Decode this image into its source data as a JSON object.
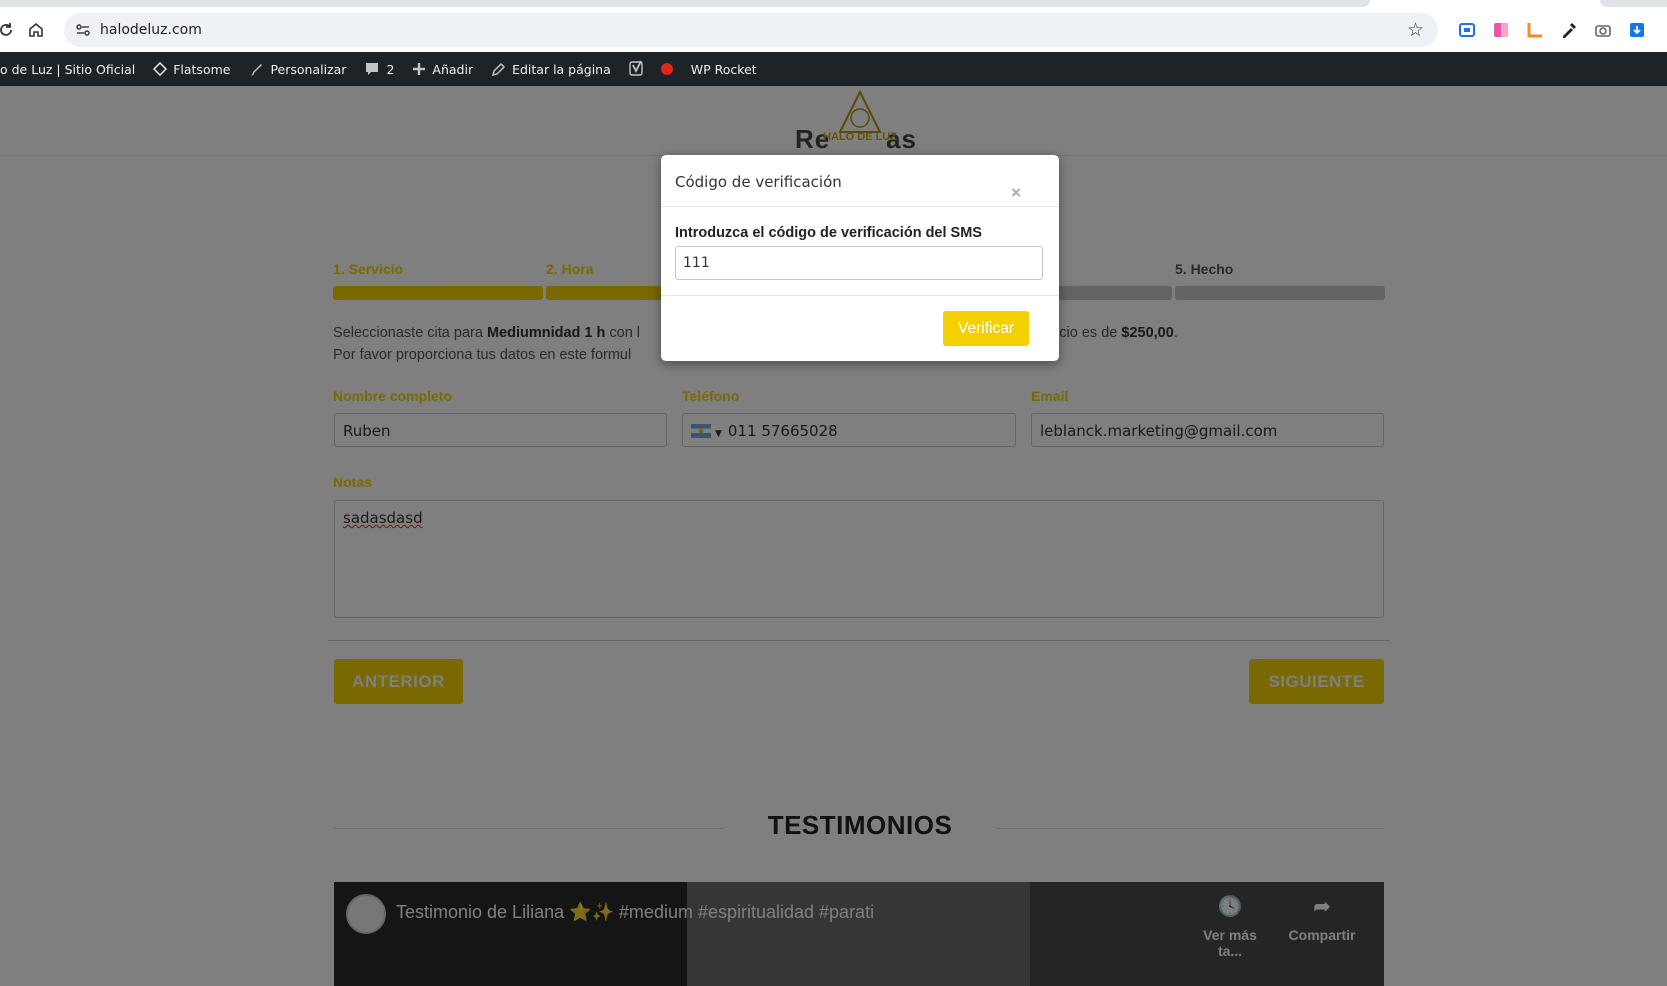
{
  "browser": {
    "url": "halodeluz.com",
    "icons": [
      "reload-icon",
      "home-icon",
      "site-info-icon",
      "star-icon"
    ]
  },
  "admin_bar": {
    "items": [
      {
        "label": "o de Luz | Sitio Oficial",
        "icon": ""
      },
      {
        "label": "Flatsome",
        "icon": "diamond-icon"
      },
      {
        "label": "Personalizar",
        "icon": "brush-icon"
      },
      {
        "label": "2",
        "icon": "comment-icon"
      },
      {
        "label": "Añadir",
        "icon": "plus-icon"
      },
      {
        "label": "Editar la página",
        "icon": "pencil-icon"
      },
      {
        "label": "WP Rocket",
        "icon": "yoast-icon"
      }
    ]
  },
  "page": {
    "hidden_title_left": "Re",
    "hidden_title_right": "as",
    "logo_text": "HALO DE LUZ",
    "steps": [
      {
        "label": "1. Servicio",
        "state": "active"
      },
      {
        "label": "2. Hora",
        "state": "active"
      },
      {
        "label": "",
        "state": "active"
      },
      {
        "label": "",
        "state": "inactive"
      },
      {
        "label": "5. Hecho",
        "state": "inactive"
      }
    ],
    "summary": {
      "line1_a": "Seleccionaste cita para ",
      "service": "Mediumnidad 1 h",
      "line1_b": " con l",
      "line1_c": "rvicio es de ",
      "price": "$250,00",
      "line1_d": ".",
      "line2": "Por favor proporciona tus datos en este formul"
    },
    "form": {
      "name_label": "Nombre completo",
      "name_value": "Ruben",
      "phone_label": "Teléfono",
      "phone_value": "011 57665028",
      "email_label": "Email",
      "email_value": "leblanck.marketing@gmail.com",
      "notes_label": "Notas",
      "notes_value": "sadasdasd"
    },
    "buttons": {
      "prev": "ANTERIOR",
      "next": "SIGUIENTE"
    },
    "testimonials_heading": "TESTIMONIOS",
    "video": {
      "title": "Testimonio de Liliana ⭐✨ #medium #espiritualidad #parati",
      "watch_later": "Ver más ta...",
      "share": "Compartir"
    }
  },
  "modal": {
    "title": "Código de verificación",
    "close": "×",
    "label": "Introduzca el código de verificación del SMS",
    "code_value": "111",
    "verify": "Verificar"
  },
  "colors": {
    "accent": "#f5d000",
    "admin_bar": "#1d2327",
    "overlay": "rgba(0,0,0,0.5)"
  }
}
